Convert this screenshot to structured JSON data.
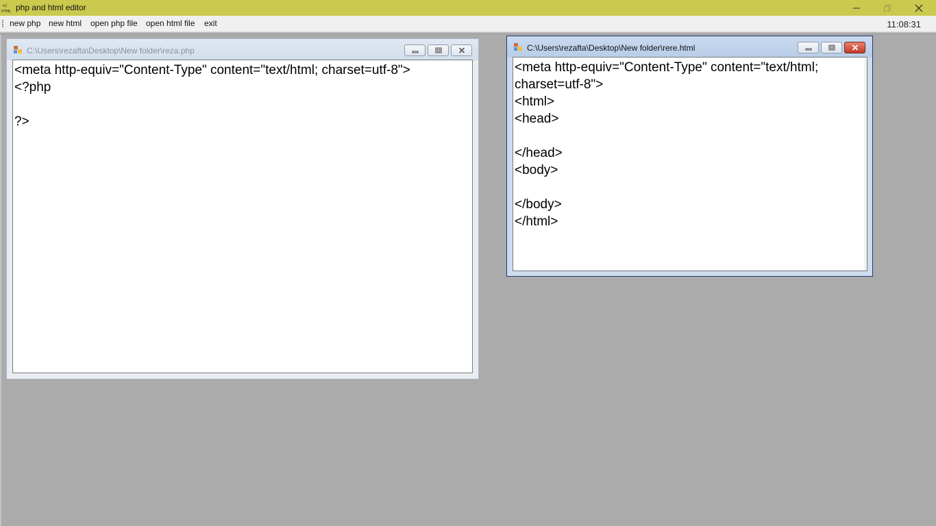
{
  "app": {
    "title": "php and html editor",
    "icon": "php-html-editor-app-icon"
  },
  "menu": {
    "items": [
      "new php",
      "new html",
      "open php file",
      "open html file",
      "exit"
    ],
    "clock": "11:08:31"
  },
  "windows": [
    {
      "path": "C:\\Users\\rezafta\\Desktop\\New folder\\reza.php",
      "active": false,
      "content": "<meta http-equiv=\"Content-Type\" content=\"text/html; charset=utf-8\">\n<?php\n\n?>"
    },
    {
      "path": "C:\\Users\\rezafta\\Desktop\\New folder\\rere.html",
      "active": true,
      "content": "<meta http-equiv=\"Content-Type\" content=\"text/html;\ncharset=utf-8\">\n<html>\n<head>\n\n</head>\n<body>\n\n</body>\n</html>"
    }
  ],
  "colors": {
    "titlebar": "#cbc94e",
    "mdi_background": "#ababab",
    "active_close_button": "#c53a27"
  }
}
